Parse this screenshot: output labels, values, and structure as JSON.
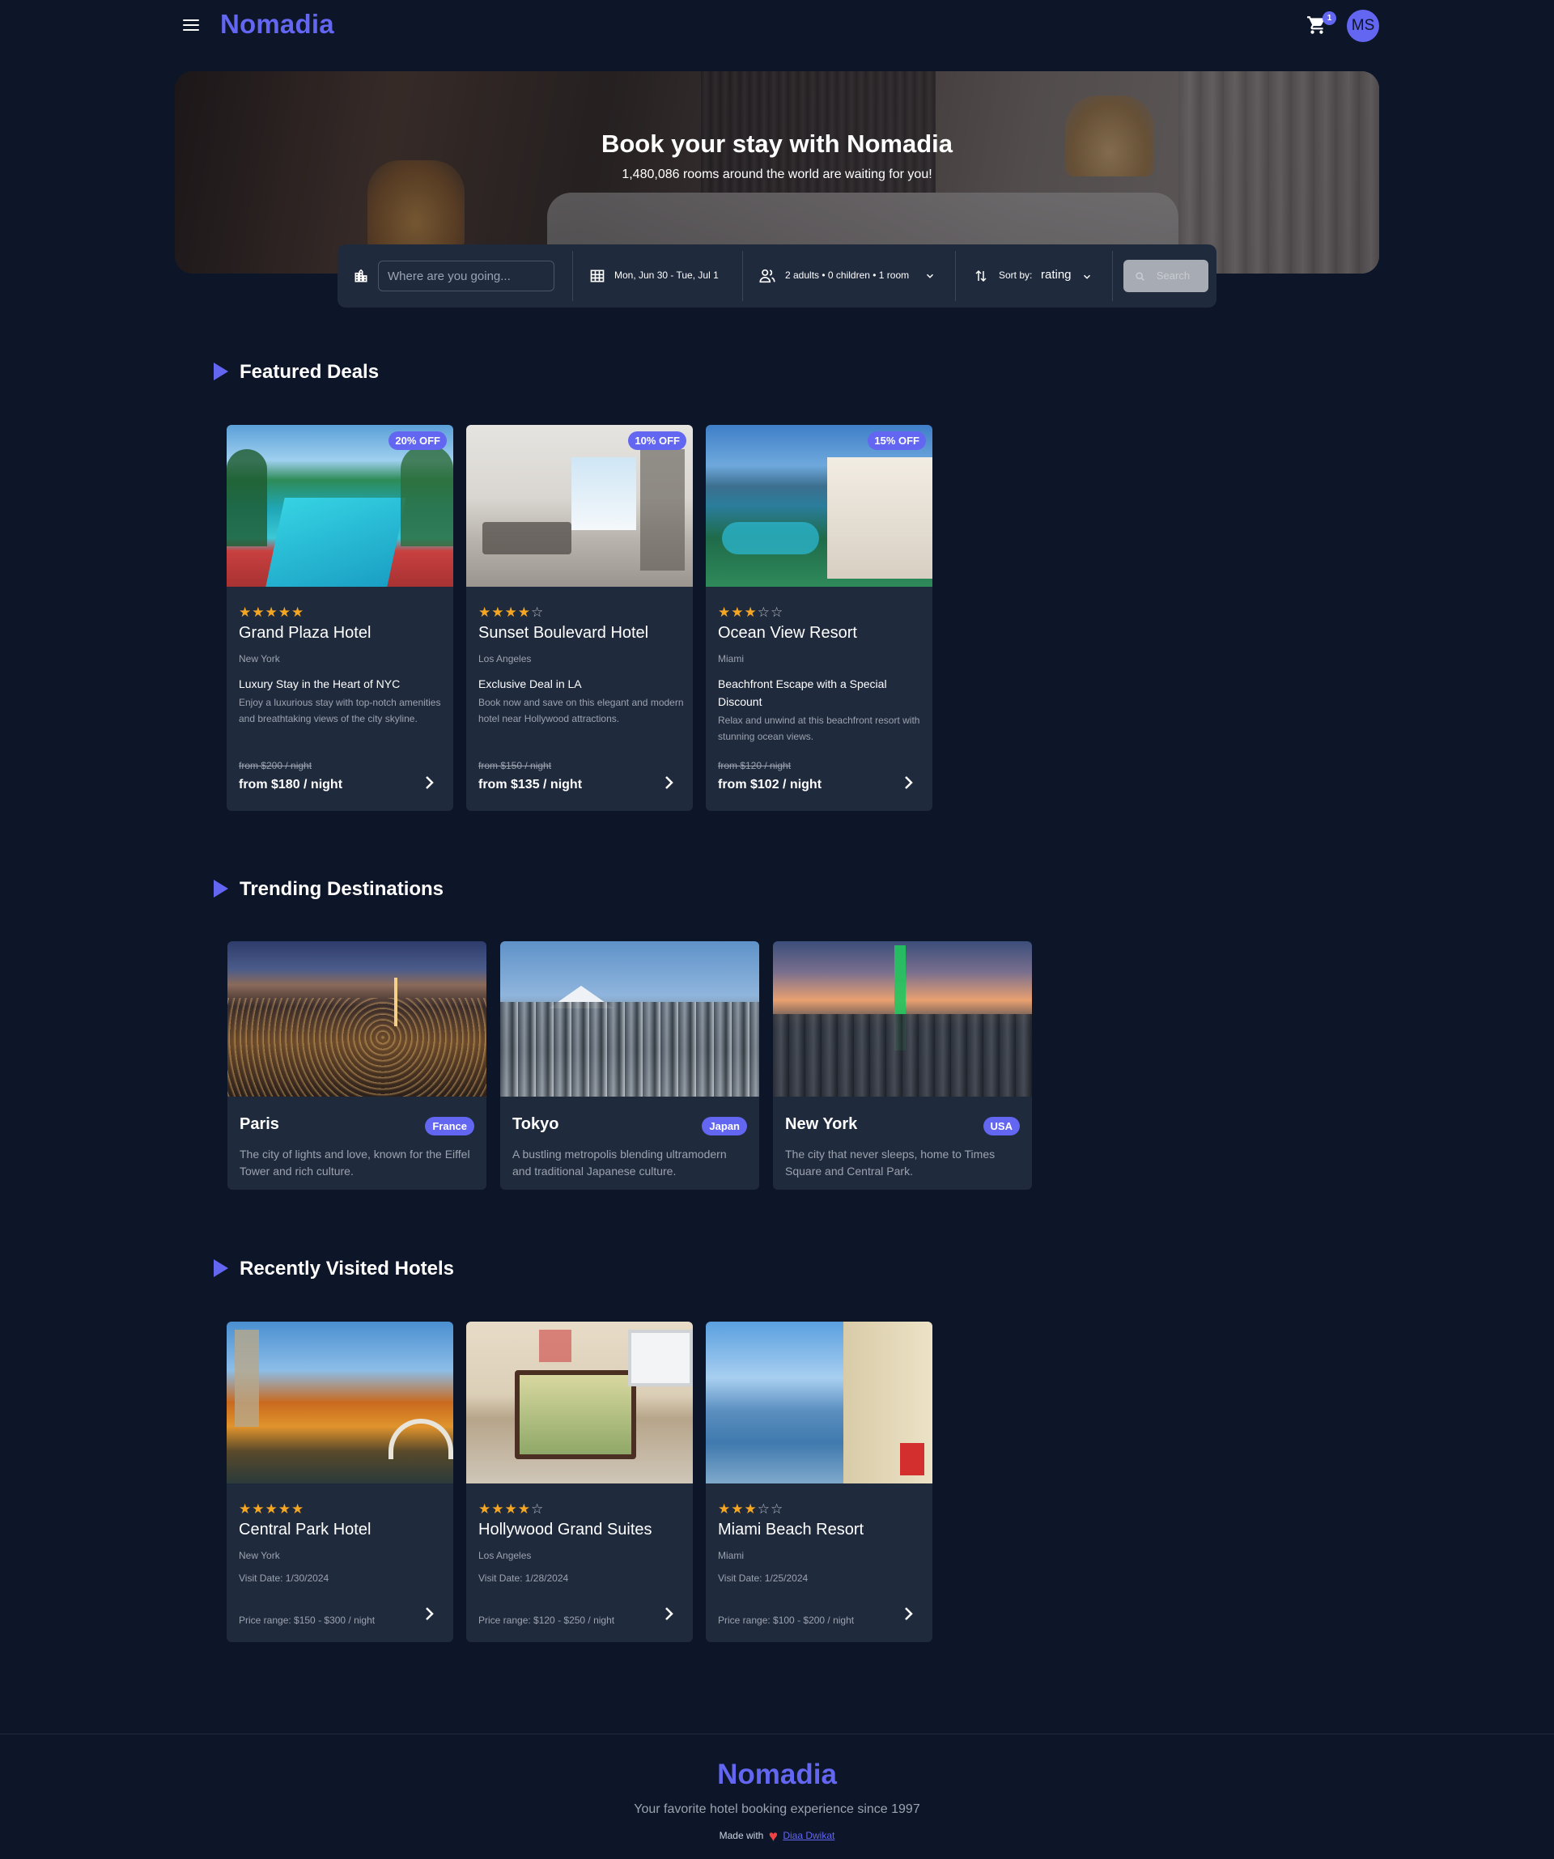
{
  "header": {
    "logo": "Nomadia",
    "cart_count": "1",
    "avatar_initials": "MS"
  },
  "hero": {
    "title": "Book your stay with Nomadia",
    "subtitle": "1,480,086 rooms around the world are waiting for you!"
  },
  "search": {
    "destination_placeholder": "Where are you going...",
    "dates": "Mon, Jun 30 - Tue, Jul 1",
    "guests": "2 adults • 0 children • 1 room",
    "sort_label": "Sort by:",
    "sort_value": "rating",
    "search_button": "Search"
  },
  "featured": {
    "title": "Featured Deals",
    "cards": [
      {
        "badge": "20% OFF",
        "stars": 5,
        "name": "Grand Plaza Hotel",
        "city": "New York",
        "headline": "Luxury Stay in the Heart of NYC",
        "description": "Enjoy a luxurious stay with top-notch amenities and breathtaking views of the city skyline.",
        "old_price": "from $200 / night",
        "price": "from $180 / night"
      },
      {
        "badge": "10% OFF",
        "stars": 4,
        "name": "Sunset Boulevard Hotel",
        "city": "Los Angeles",
        "headline": "Exclusive Deal in LA",
        "description": "Book now and save on this elegant and modern hotel near Hollywood attractions.",
        "old_price": "from $150 / night",
        "price": "from $135 / night"
      },
      {
        "badge": "15% OFF",
        "stars": 3,
        "name": "Ocean View Resort",
        "city": "Miami",
        "headline": "Beachfront Escape with a Special Discount",
        "description": "Relax and unwind at this beachfront resort with stunning ocean views.",
        "old_price": "from $120 / night",
        "price": "from $102 / night"
      }
    ]
  },
  "trending": {
    "title": "Trending Destinations",
    "cards": [
      {
        "name": "Paris",
        "country": "France",
        "description": "The city of lights and love, known for the Eiffel Tower and rich culture."
      },
      {
        "name": "Tokyo",
        "country": "Japan",
        "description": "A bustling metropolis blending ultramodern and traditional Japanese culture."
      },
      {
        "name": "New York",
        "country": "USA",
        "description": "The city that never sleeps, home to Times Square and Central Park."
      }
    ]
  },
  "recent": {
    "title": "Recently Visited Hotels",
    "cards": [
      {
        "stars": 5,
        "name": "Central Park Hotel",
        "city": "New York",
        "visit": "Visit Date: 1/30/2024",
        "range": "Price range: $150 - $300 / night"
      },
      {
        "stars": 4,
        "name": "Hollywood Grand Suites",
        "city": "Los Angeles",
        "visit": "Visit Date: 1/28/2024",
        "range": "Price range: $120 - $250 / night"
      },
      {
        "stars": 3,
        "name": "Miami Beach Resort",
        "city": "Miami",
        "visit": "Visit Date: 1/25/2024",
        "range": "Price range: $100 - $200 / night"
      }
    ]
  },
  "footer": {
    "logo": "Nomadia",
    "tagline": "Your favorite hotel booking experience since 1997",
    "made_with": "Made with",
    "author": "Diaa Dwikat"
  },
  "colors": {
    "background": "#0d1528",
    "card": "#1f2a3d",
    "accent": "#6366f1",
    "star": "#f5a623"
  }
}
